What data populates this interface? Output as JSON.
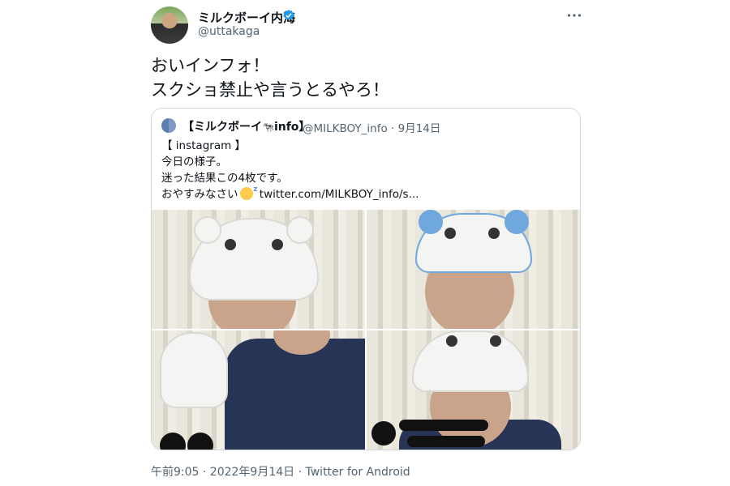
{
  "tweet": {
    "display_name": "ミルクボーイ内海",
    "handle": "@uttakaga",
    "verified": true,
    "text": "おいインフォ！\nスクショ禁止や言うとるやろ！",
    "timestamp": "午前9:05 · 2022年9月14日 · Twitter for Android"
  },
  "quote": {
    "name": "【ミルクボーイ",
    "name_suffix": "info】",
    "meta": "@MILKBOY_info · 9月14日",
    "lines": [
      "【 instagram 】",
      "今日の様子。",
      "迷った結果この4枚です。"
    ],
    "last_line_prefix": "おやすみなさい",
    "last_line_link": "twitter.com/MILKBOY_info/s..."
  },
  "colors": {
    "verified": "#1d9bf0",
    "muted": "#536471",
    "border": "#cfd9de"
  },
  "icons": {
    "verified": "verified-badge-icon",
    "more": "more-options-icon",
    "emoji": "sleeping-face-emoji",
    "cow": "cow-emoji"
  }
}
